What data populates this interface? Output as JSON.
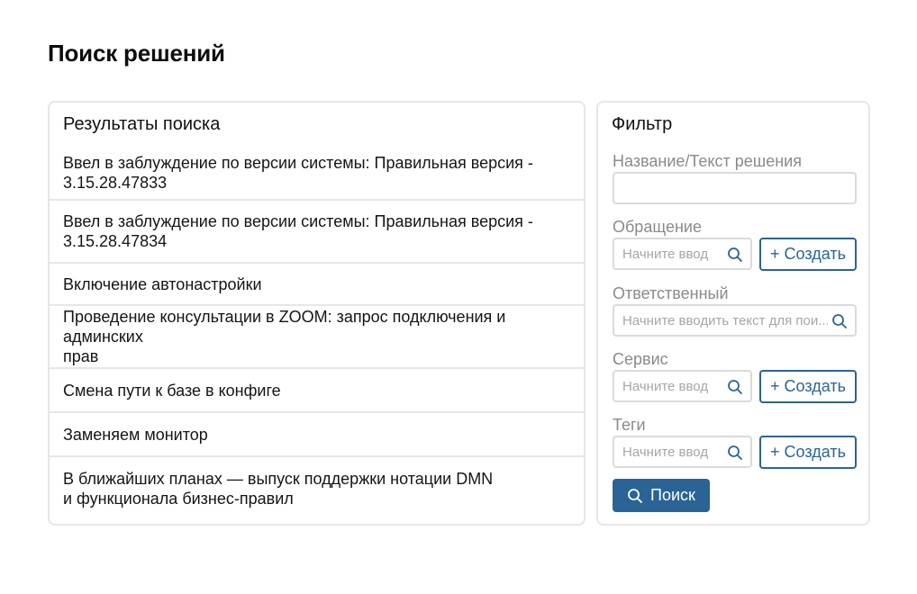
{
  "page": {
    "title": "Поиск решений"
  },
  "results": {
    "title": "Результаты поиска",
    "items": [
      {
        "text": "Ввел в заблуждение по версии системы: Правильная версия -\n3.15.28.47833"
      },
      {
        "text": "Ввел в заблуждение по версии системы: Правильная версия -\n3.15.28.47834"
      },
      {
        "text": "Включение автонастройки"
      },
      {
        "text": "Проведение консультации в ZOOM: запрос подключения и админских\nправ"
      },
      {
        "text": "Смена пути к базе в конфиге"
      },
      {
        "text": "Заменяем монитор"
      },
      {
        "text": "В ближайших планах — выпуск поддержки нотации DMN\nи функционала бизнес-правил"
      }
    ]
  },
  "filter": {
    "title": "Фильтр",
    "name_label": "Название/Текст решения",
    "name_value": "",
    "request_label": "Обращение",
    "request_placeholder": "Начните ввод",
    "responsible_label": "Ответственный",
    "responsible_placeholder": "Начните вводить текст для пои...",
    "service_label": "Сервис",
    "service_placeholder": "Начните ввод",
    "tags_label": "Теги",
    "tags_placeholder": "Начните ввод",
    "create_label": "+ Создать",
    "search_label": "Поиск"
  },
  "colors": {
    "accent": "#2a6496",
    "border": "#e6e6e6",
    "muted_text": "#8a8a8a"
  },
  "icons": {
    "search": "search-icon"
  }
}
